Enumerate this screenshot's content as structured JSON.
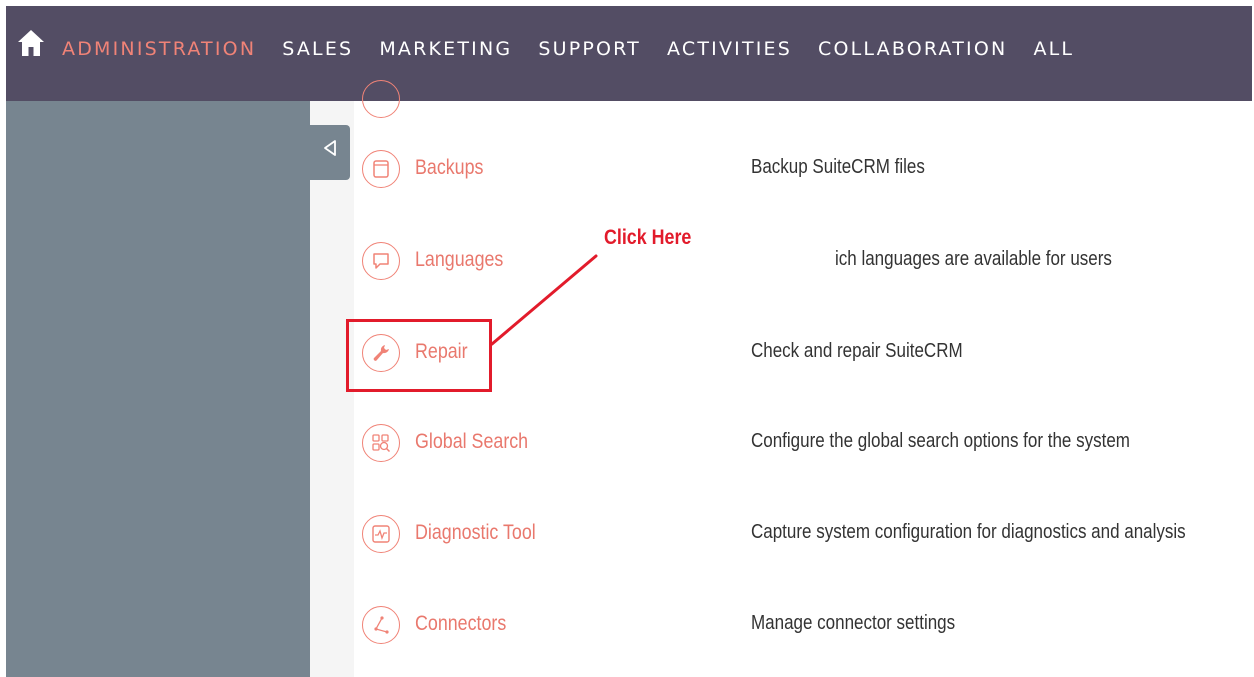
{
  "nav": {
    "home_icon": "home-icon",
    "items": [
      {
        "label": "ADMINISTRATION",
        "active": true
      },
      {
        "label": "SALES",
        "active": false
      },
      {
        "label": "MARKETING",
        "active": false
      },
      {
        "label": "SUPPORT",
        "active": false
      },
      {
        "label": "ACTIVITIES",
        "active": false
      },
      {
        "label": "COLLABORATION",
        "active": false
      },
      {
        "label": "ALL",
        "active": false
      }
    ]
  },
  "admin_rows": [
    {
      "label": "Backups",
      "description": "Backup SuiteCRM files",
      "icon": "backup-icon"
    },
    {
      "label": "Languages",
      "description": "ich languages are available for users",
      "icon": "speech-bubble-icon"
    },
    {
      "label": "Repair",
      "description": "Check and repair SuiteCRM",
      "icon": "wrench-icon"
    },
    {
      "label": "Global Search",
      "description": "Configure the global search options for the system",
      "icon": "global-search-icon"
    },
    {
      "label": "Diagnostic Tool",
      "description": "Capture system configuration for diagnostics and analysis",
      "icon": "diagnostic-monitor-icon"
    },
    {
      "label": "Connectors",
      "description": "Manage connector settings",
      "icon": "connectors-icon"
    }
  ],
  "annotation": {
    "text": "Click Here"
  },
  "colors": {
    "navbar_bg": "#534d64",
    "accent": "#f08377",
    "sidebar_bg": "#778590",
    "annotation_red": "#e21b2b"
  }
}
